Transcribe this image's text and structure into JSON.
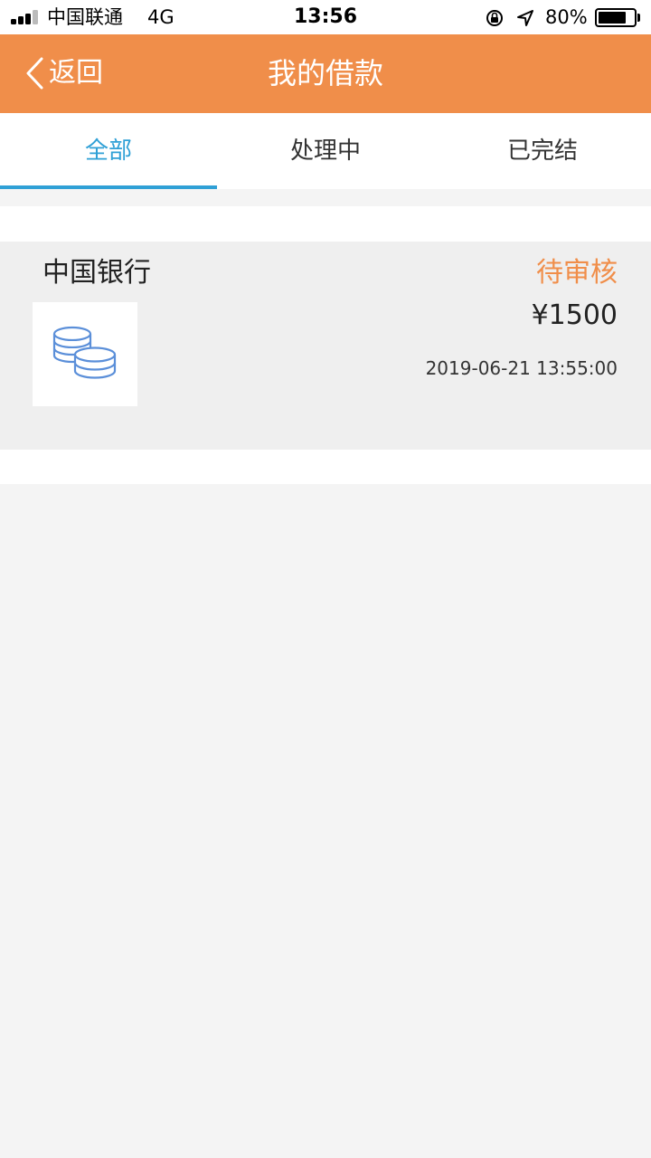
{
  "status_bar": {
    "carrier": "中国联通",
    "network": "4G",
    "time": "13:56",
    "battery_percent_text": "80%",
    "battery_level": 0.8,
    "icons": [
      "signal-icon",
      "orientation-lock-icon",
      "location-icon",
      "battery-icon"
    ]
  },
  "nav": {
    "back_label": "返回",
    "title": "我的借款",
    "background_color": "#f08e4a"
  },
  "tabs": [
    {
      "label": "全部",
      "active": true
    },
    {
      "label": "处理中",
      "active": false
    },
    {
      "label": "已完结",
      "active": false
    }
  ],
  "loans": [
    {
      "bank": "中国银行",
      "status": "待审核",
      "amount": "¥1500",
      "time": "2019-06-21 13:55:00",
      "icon": "coins-icon"
    }
  ],
  "colors": {
    "accent_blue": "#2fa0d6",
    "status_orange": "#f08e4a",
    "icon_blue": "#5b8fd9"
  }
}
